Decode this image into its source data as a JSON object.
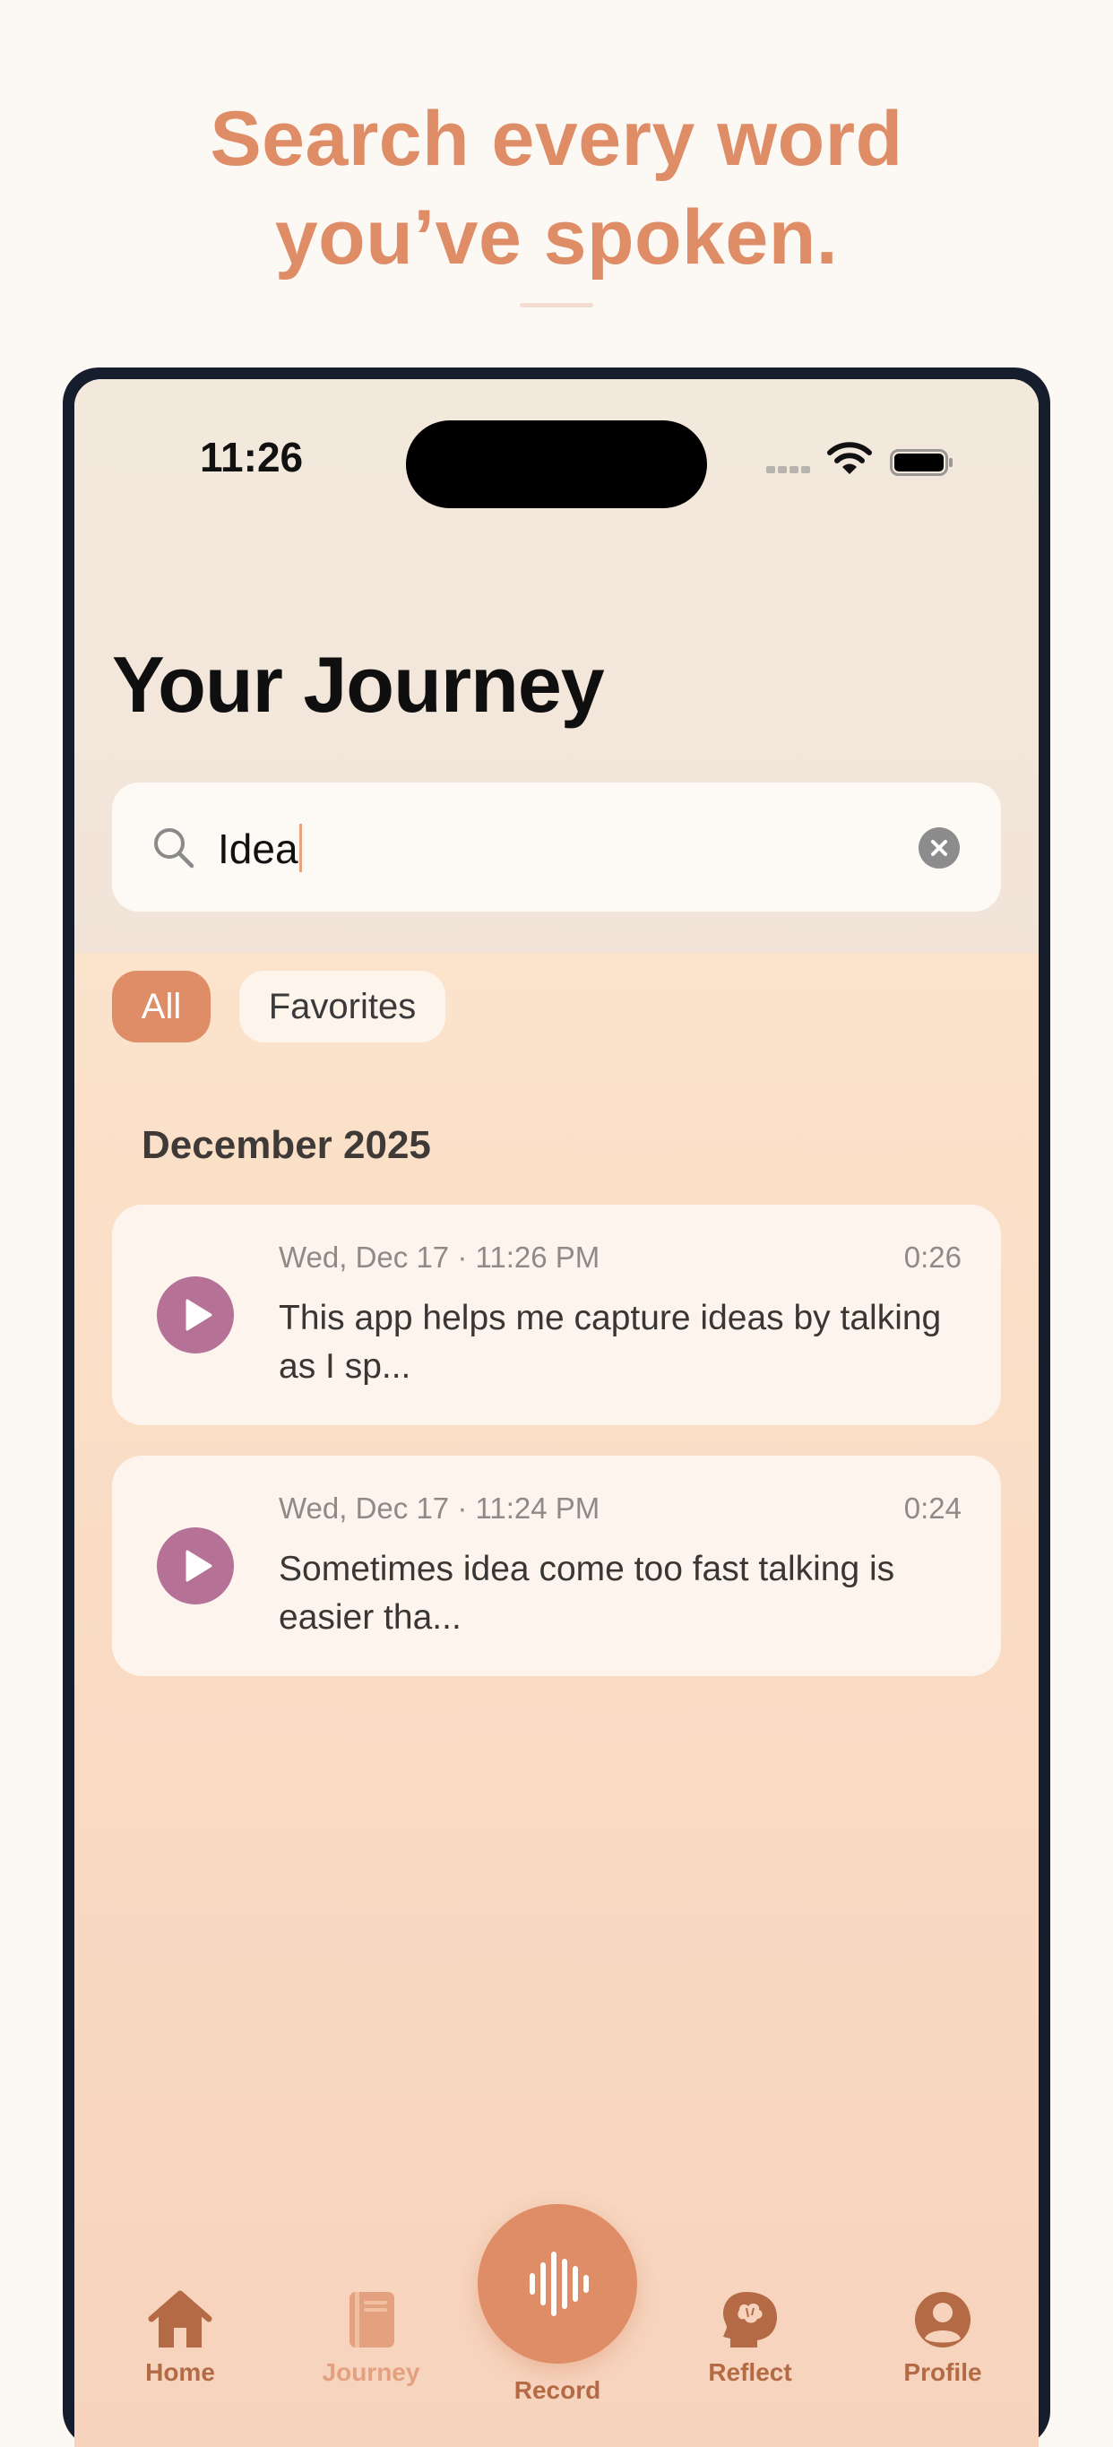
{
  "marketing": {
    "headline_line1": "Search every word",
    "headline_line2": "you’ve spoken."
  },
  "status_bar": {
    "time": "11:26",
    "icons": [
      "cellular-signal-icon",
      "wifi-icon",
      "battery-icon"
    ]
  },
  "page": {
    "title": "Your Journey"
  },
  "search": {
    "value": "Idea",
    "icon": "search-icon",
    "clear_icon": "clear-icon"
  },
  "filters": {
    "items": [
      {
        "label": "All",
        "selected": true
      },
      {
        "label": "Favorites",
        "selected": false
      }
    ]
  },
  "section": {
    "title": "December 2025"
  },
  "entries": [
    {
      "meta": "Wed, Dec 17 · 11:26 PM",
      "duration": "0:26",
      "text": "This app helps me capture ideas by talking as I sp..."
    },
    {
      "meta": "Wed, Dec 17 · 11:24 PM",
      "duration": "0:24",
      "text": "Sometimes idea come too fast talking is easier tha..."
    }
  ],
  "tabbar": {
    "items": [
      {
        "label": "Home",
        "icon": "house-icon"
      },
      {
        "label": "Journey",
        "icon": "book-icon",
        "active": true
      },
      {
        "label": "Record",
        "icon": "waveform-icon"
      },
      {
        "label": "Reflect",
        "icon": "brain-head-icon"
      },
      {
        "label": "Profile",
        "icon": "person-circle-icon"
      }
    ]
  },
  "colors": {
    "accent": "#de8d66",
    "play_button": "#b57296",
    "background": "#fcf8f3",
    "phone_frame": "#161d2c"
  }
}
